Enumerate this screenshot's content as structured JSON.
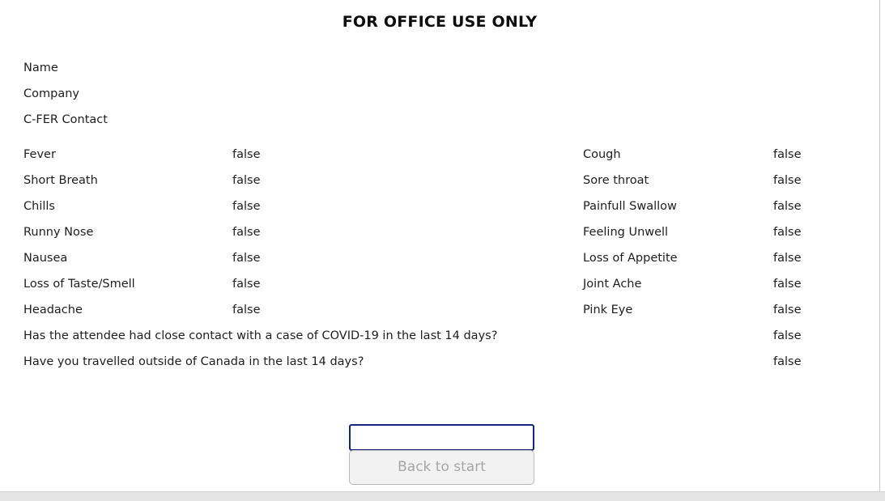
{
  "header": {
    "title": "FOR OFFICE USE ONLY"
  },
  "identity": {
    "fields": [
      {
        "label": "Name",
        "value": ""
      },
      {
        "label": "Company",
        "value": ""
      },
      {
        "label": "C-FER Contact",
        "value": ""
      }
    ]
  },
  "symptoms": {
    "left_column": [
      {
        "label": "Fever",
        "value": "false"
      },
      {
        "label": "Short Breath",
        "value": "false"
      },
      {
        "label": "Chills",
        "value": "false"
      },
      {
        "label": "Runny Nose",
        "value": "false"
      },
      {
        "label": "Nausea",
        "value": "false"
      },
      {
        "label": "Loss of Taste/Smell",
        "value": "false"
      },
      {
        "label": "Headache",
        "value": "false"
      }
    ],
    "right_column": [
      {
        "label": "Cough",
        "value": "false"
      },
      {
        "label": "Sore throat",
        "value": "false"
      },
      {
        "label": "Painfull Swallow",
        "value": "false"
      },
      {
        "label": "Feeling Unwell",
        "value": "false"
      },
      {
        "label": "Loss of Appetite",
        "value": "false"
      },
      {
        "label": "Joint Ache",
        "value": "false"
      },
      {
        "label": "Pink Eye",
        "value": "false"
      }
    ]
  },
  "questions": [
    {
      "label": "Has the attendee had close contact with a case of COVID-19 in the last 14 days?",
      "value": "false"
    },
    {
      "label": "Have you travelled outside of Canada in the last 14 days?",
      "value": "false"
    }
  ],
  "controls": {
    "text_input": {
      "value": "",
      "placeholder": ""
    },
    "back_button": {
      "label": "Back to start"
    }
  },
  "colors": {
    "input_border": "#16257d",
    "button_background": "#f2f2f2",
    "button_text": "#a6a6a6",
    "page_background": "#ffffff",
    "text": "#1e1e1e"
  }
}
